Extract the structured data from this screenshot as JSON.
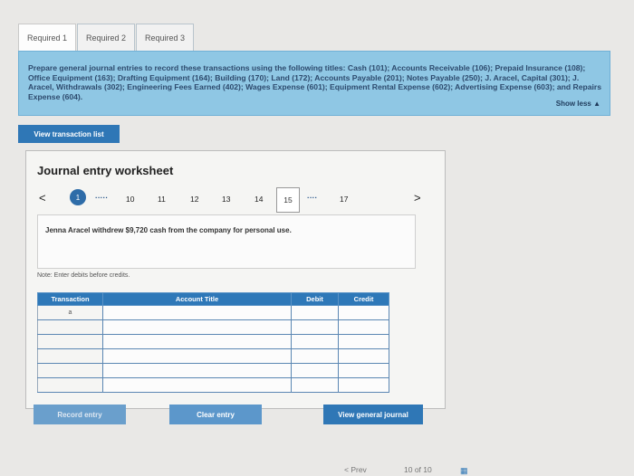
{
  "tabs": [
    {
      "label": "Required 1"
    },
    {
      "label": "Required 2"
    },
    {
      "label": "Required 3"
    }
  ],
  "instructions": {
    "text": "Prepare general journal entries to record these transactions using the following titles: Cash (101); Accounts Receivable (106); Prepaid Insurance (108); Office Equipment (163); Drafting Equipment (164); Building (170); Land (172); Accounts Payable (201); Notes Payable (250); J. Aracel, Capital (301); J. Aracel, Withdrawals (302); Engineering Fees Earned (402); Wages Expense (601); Equipment Rental Expense (602); Advertising Expense (603); and Repairs Expense (604).",
    "show_less": "Show less ▲"
  },
  "view_list_label": "View transaction list",
  "worksheet": {
    "title": "Journal entry worksheet",
    "pager": {
      "prev": "<",
      "first": "1",
      "dots1": "·····",
      "pages": [
        "10",
        "11",
        "12",
        "13",
        "14",
        "15"
      ],
      "dots2": "····",
      "last": "17",
      "next": ">",
      "active": "15"
    },
    "scenario": "Jenna Aracel withdrew $9,720 cash from the company for personal use.",
    "note": "Note: Enter debits before credits.",
    "columns": [
      "Transaction",
      "Account Title",
      "Debit",
      "Credit"
    ],
    "first_transaction": "a",
    "row_count": 6
  },
  "buttons": {
    "record": "Record entry",
    "clear": "Clear entry",
    "view_journal": "View general journal"
  },
  "footer": {
    "prev": "< Prev",
    "page": "10 of 10"
  },
  "colors": {
    "accent": "#2f77b6",
    "instruction_bg": "#8fc7e4"
  }
}
